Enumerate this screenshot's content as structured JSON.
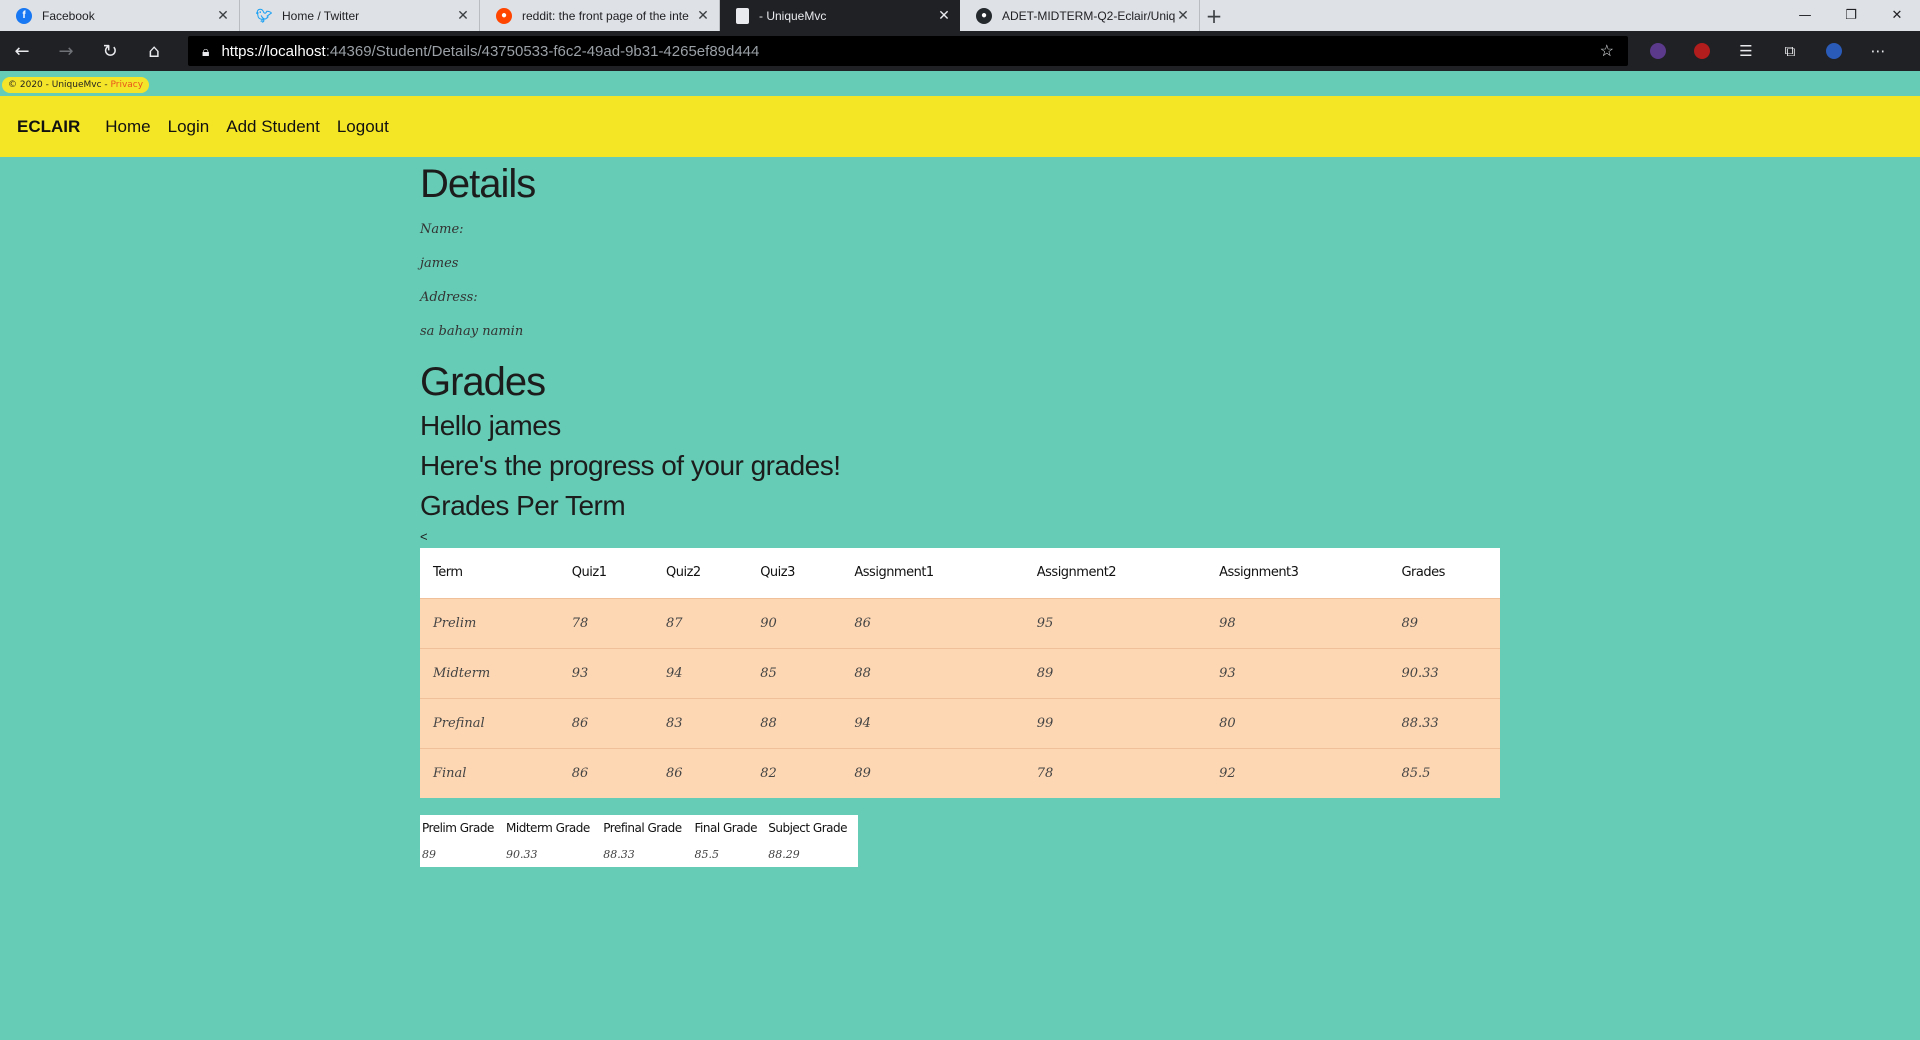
{
  "browser": {
    "tabs": [
      {
        "title": "Facebook",
        "icon": "facebook-icon",
        "color": "#1877f2"
      },
      {
        "title": "Home / Twitter",
        "icon": "twitter-icon",
        "color": "#1da1f2"
      },
      {
        "title": "reddit: the front page of the inte",
        "icon": "reddit-icon",
        "color": "#ff4500"
      },
      {
        "title": "- UniqueMvc",
        "icon": "page-icon",
        "color": "#e8eaed"
      },
      {
        "title": "ADET-MIDTERM-Q2-Eclair/Uniq",
        "icon": "github-icon",
        "color": "#e8eaed"
      }
    ],
    "url_host": "https://localhost",
    "url_path": ":44369/Student/Details/43750533-f6c2-49ad-9b31-4265ef89d444"
  },
  "footer": {
    "copyright": "© 2020 - UniqueMvc - ",
    "privacy": "Privacy"
  },
  "nav": {
    "brand": "ECLAIR",
    "links": [
      "Home",
      "Login",
      "Add Student",
      "Logout"
    ]
  },
  "details": {
    "heading": "Details",
    "name_label": "Name:",
    "name_value": "james",
    "address_label": "Address:",
    "address_value": "sa bahay namin"
  },
  "grades": {
    "heading": "Grades",
    "greeting": "Hello james",
    "progress": "Here's the progress of your grades!",
    "per_term": "Grades Per Term",
    "stray": "<",
    "columns": [
      "Term",
      "Quiz1",
      "Quiz2",
      "Quiz3",
      "Assignment1",
      "Assignment2",
      "Assignment3",
      "Grades"
    ],
    "rows": [
      [
        "Prelim",
        "78",
        "87",
        "90",
        "86",
        "95",
        "98",
        "89"
      ],
      [
        "Midterm",
        "93",
        "94",
        "85",
        "88",
        "89",
        "93",
        "90.33"
      ],
      [
        "Prefinal",
        "86",
        "83",
        "88",
        "94",
        "99",
        "80",
        "88.33"
      ],
      [
        "Final",
        "86",
        "86",
        "82",
        "89",
        "78",
        "92",
        "85.5"
      ]
    ]
  },
  "summary": {
    "columns": [
      "Prelim Grade",
      "Midterm Grade",
      "Prefinal Grade",
      "Final Grade",
      "Subject Grade"
    ],
    "values": [
      "89",
      "90.33",
      "88.33",
      "85.5",
      "88.29"
    ]
  }
}
